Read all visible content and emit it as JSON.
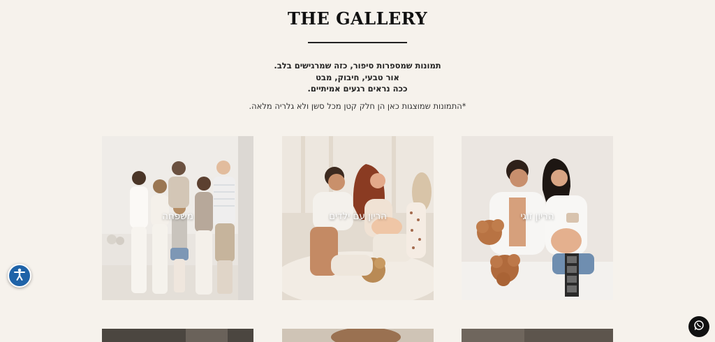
{
  "gallery": {
    "title": "THE GALLERY",
    "intro_lines": [
      "תמונות שמספרות סיפור, כזה שמרגישים בלב.",
      "אור טבעי, חיבוק, מבט",
      "ככה נראים רגעים אמיתיים."
    ],
    "note": "*התמונות שמוצגות כאן הן חלק קטן מכל סשן ולא גלריה מלאה."
  },
  "tiles": [
    {
      "label": "משפחה"
    },
    {
      "label": "הריון עם ילדים"
    },
    {
      "label": "הריון זוגי"
    }
  ],
  "floating": {
    "accessibility_icon": "accessibility-icon",
    "whatsapp_icon": "whatsapp-icon"
  },
  "colors": {
    "background": "#f6f2ec",
    "accessibility": "#1f63a8",
    "whatsapp": "#111111"
  }
}
